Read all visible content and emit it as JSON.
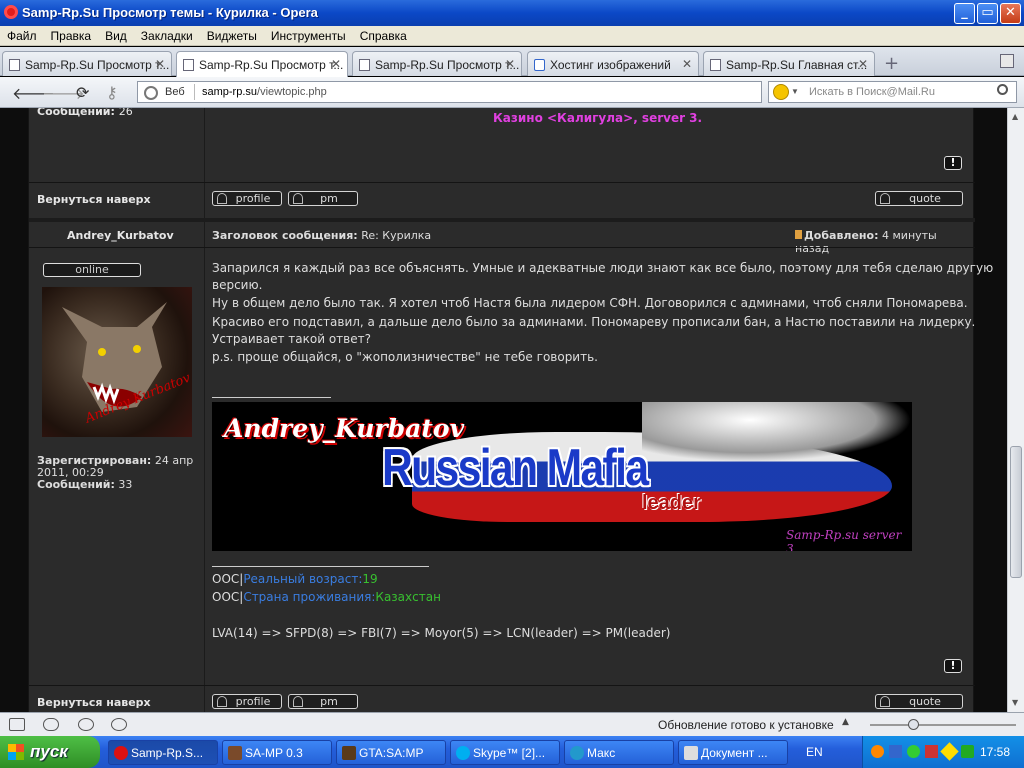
{
  "window": {
    "title": "Samp-Rp.Su Просмотр темы - Курилка - Opera",
    "controls": [
      "_",
      "▭",
      "✕"
    ]
  },
  "menu": [
    "Файл",
    "Правка",
    "Вид",
    "Закладки",
    "Виджеты",
    "Инструменты",
    "Справка"
  ],
  "tabs": [
    {
      "label": "Samp-Rp.Su Просмотр т...",
      "active": false
    },
    {
      "label": "Samp-Rp.Su Просмотр т...",
      "active": true
    },
    {
      "label": "Samp-Rp.Su Просмотр т...",
      "active": false
    },
    {
      "label": "Хостинг изображений",
      "active": false
    },
    {
      "label": "Samp-Rp.Su Главная ст...",
      "active": false
    }
  ],
  "tab_close": "✕",
  "new_tab": "+",
  "nav": {
    "back": "🡐",
    "forward": "🡒",
    "reload": "⟳",
    "key": "⚷"
  },
  "address": {
    "scheme_label": "Веб",
    "host": "samp-rp.su",
    "path": "/viewtopic.php"
  },
  "search": {
    "placeholder": "Искать в Поиск@Mail.Ru"
  },
  "prev_post": {
    "posts_label": "Сообщений:",
    "posts_value": "26",
    "signature_line": "Казино <Калигула>, server 3.",
    "back_to_top": "Вернуться наверх"
  },
  "post": {
    "author": "Andrey_Kurbatov",
    "subject_label": "Заголовок сообщения:",
    "subject_value": "Re: Курилка",
    "added_label": "Добавлено:",
    "added_value": "4 минуты назад",
    "online": "online",
    "avatar_text": "Andrey Kurbatov",
    "registered_label": "Зарегистрирован:",
    "registered_value": "24 апр 2011, 00:29",
    "posts_label": "Сообщений:",
    "posts_value": "33",
    "lines": [
      "Запарился я каждый раз все объяснять. Умные и адекватные люди знают как все было, поэтому для тебя сделаю другую",
      "версию.",
      "Ну в общем дело было так. Я хотел чтоб Настя была лидером СФН. Договорился с админами, чтоб сняли Пономарева.",
      "Красиво его подставил, а дальше дело было за админами. Пономареву прописали бан, а Настю поставили на лидерку.",
      "Устраивает такой ответ?",
      "p.s. проще общайся, о \"жополизничестве\" не тебе говорить."
    ],
    "banner": {
      "name": "Andrey_Kurbatov",
      "title": "Russian Mafia",
      "sub": "leader",
      "server": "Samp-Rp.su server 3"
    },
    "sig_ooc1_prefix": "OOC|",
    "sig_ooc1_label": "Реальный возраст:",
    "sig_ooc1_value": "19",
    "sig_ooc2_prefix": "OOC|",
    "sig_ooc2_label": "Страна проживания:",
    "sig_ooc2_value": "Казахстан",
    "sig_career": "LVA(14) => SFPD(8) => FBI(7) => Moyor(5) => LCN(leader) => PM(leader)",
    "back_to_top": "Вернуться наверх"
  },
  "buttons": {
    "profile": "profile",
    "pm": "pm",
    "quote": "quote",
    "report": "!"
  },
  "status": {
    "update": "Обновление готово к установке"
  },
  "taskbar": {
    "start": "пуск",
    "items": [
      "Samp-Rp.S...",
      "SA-MP 0.3",
      "GTA:SA:MP",
      "Skype™ [2]...",
      "Макс",
      "Документ ..."
    ],
    "lang": "EN",
    "clock": "17:58"
  },
  "colors": {
    "sig_pink": "#e040e0",
    "blue_label": "#3a7de0",
    "green_value": "#38c030",
    "accent_yellow": "#ffd24a"
  }
}
